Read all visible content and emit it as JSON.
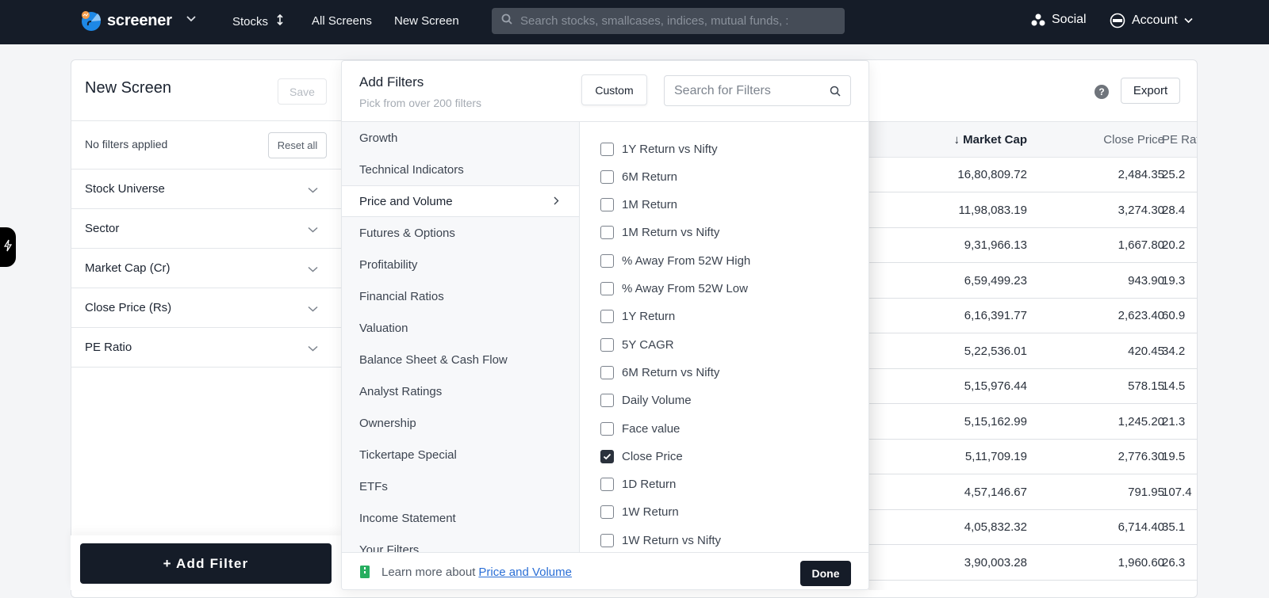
{
  "topnav": {
    "brand": "screener",
    "links": {
      "stocks": "Stocks",
      "all_screens": "All Screens",
      "new_screen": "New Screen"
    },
    "search_placeholder": "Search stocks, smallcases, indices, mutual funds, :",
    "social": "Social",
    "account": "Account"
  },
  "left_panel": {
    "title": "New Screen",
    "save_label": "Save",
    "no_filters_text": "No filters applied",
    "reset_label": "Reset all",
    "accordion": [
      {
        "label": "Stock Universe"
      },
      {
        "label": "Sector"
      },
      {
        "label": "Market Cap (Cr)"
      },
      {
        "label": "Close Price (Rs)"
      },
      {
        "label": "PE Ratio"
      }
    ],
    "add_filter_label": "+  Add Filter"
  },
  "popover": {
    "title": "Add Filters",
    "subtitle": "Pick from over 200 filters",
    "custom_label": "Custom",
    "search_placeholder": "Search for Filters",
    "categories": [
      {
        "label": "Growth",
        "active": false
      },
      {
        "label": "Technical Indicators",
        "active": false
      },
      {
        "label": "Price and Volume",
        "active": true
      },
      {
        "label": "Futures & Options",
        "active": false
      },
      {
        "label": "Profitability",
        "active": false
      },
      {
        "label": "Financial Ratios",
        "active": false
      },
      {
        "label": "Valuation",
        "active": false
      },
      {
        "label": "Balance Sheet & Cash Flow",
        "active": false
      },
      {
        "label": "Analyst Ratings",
        "active": false
      },
      {
        "label": "Ownership",
        "active": false
      },
      {
        "label": "Tickertape Special",
        "active": false
      },
      {
        "label": "ETFs",
        "active": false
      },
      {
        "label": "Income Statement",
        "active": false
      },
      {
        "label": "Your Filters",
        "active": false
      }
    ],
    "options": [
      {
        "label": "1Y Return vs Nifty",
        "checked": false
      },
      {
        "label": "6M Return",
        "checked": false
      },
      {
        "label": "1M Return",
        "checked": false
      },
      {
        "label": "1M Return vs Nifty",
        "checked": false
      },
      {
        "label": "% Away From 52W High",
        "checked": false
      },
      {
        "label": "% Away From 52W Low",
        "checked": false
      },
      {
        "label": "1Y Return",
        "checked": false
      },
      {
        "label": "5Y CAGR",
        "checked": false
      },
      {
        "label": "6M Return vs Nifty",
        "checked": false
      },
      {
        "label": "Daily Volume",
        "checked": false
      },
      {
        "label": "Face value",
        "checked": false
      },
      {
        "label": "Close Price",
        "checked": true
      },
      {
        "label": "1D Return",
        "checked": false
      },
      {
        "label": "1W Return",
        "checked": false
      },
      {
        "label": "1W Return vs Nifty",
        "checked": false
      }
    ],
    "footer": {
      "learn_prefix": "Learn more about",
      "learn_link": "Price and Volume",
      "done_label": "Done"
    }
  },
  "table": {
    "help_icon": "?",
    "export_label": "Export",
    "headers": {
      "market_cap": "↓ Market Cap",
      "close_price": "Close Price",
      "pe_ratio": "PE Ratio"
    },
    "rows": [
      {
        "market_cap": "16,80,809.72",
        "close_price": "2,484.35",
        "pe_ratio": "25.2"
      },
      {
        "market_cap": "11,98,083.19",
        "close_price": "3,274.30",
        "pe_ratio": "28.4"
      },
      {
        "market_cap": "9,31,966.13",
        "close_price": "1,667.80",
        "pe_ratio": "20.2"
      },
      {
        "market_cap": "6,59,499.23",
        "close_price": "943.90",
        "pe_ratio": "19.3"
      },
      {
        "market_cap": "6,16,391.77",
        "close_price": "2,623.40",
        "pe_ratio": "60.9"
      },
      {
        "market_cap": "5,22,536.01",
        "close_price": "420.45",
        "pe_ratio": "34.2"
      },
      {
        "market_cap": "5,15,976.44",
        "close_price": "578.15",
        "pe_ratio": "14.5"
      },
      {
        "market_cap": "5,15,162.99",
        "close_price": "1,245.20",
        "pe_ratio": "21.3"
      },
      {
        "market_cap": "5,11,709.19",
        "close_price": "2,776.30",
        "pe_ratio": "19.5"
      },
      {
        "market_cap": "4,57,146.67",
        "close_price": "791.95",
        "pe_ratio": "107.4"
      },
      {
        "market_cap": "4,05,832.32",
        "close_price": "6,714.40",
        "pe_ratio": "35.1"
      },
      {
        "market_cap": "3,90,003.28",
        "close_price": "1,960.60",
        "pe_ratio": "26.3"
      }
    ]
  }
}
